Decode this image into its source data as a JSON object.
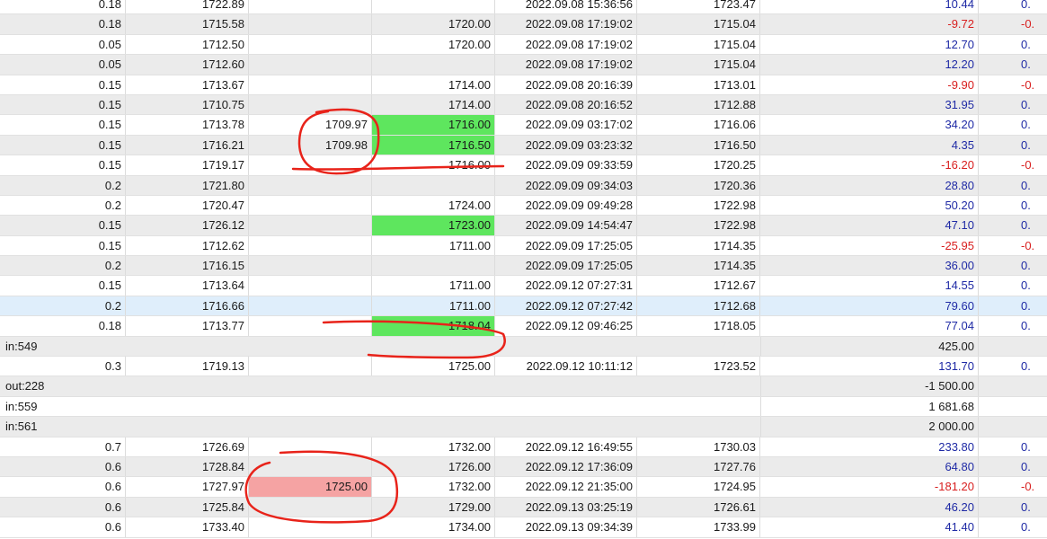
{
  "rows": [
    {
      "type": "trade",
      "alt": false,
      "lots": "0.18",
      "open": "1722.89",
      "sl": "",
      "tp": "",
      "time": "2022.09.08 15:36:56",
      "close": "1723.47",
      "profit": "10.44",
      "pc": "pos",
      "last": "0.",
      "sl_hl": "",
      "tp_hl": ""
    },
    {
      "type": "trade",
      "alt": true,
      "lots": "0.18",
      "open": "1715.58",
      "sl": "",
      "tp": "1720.00",
      "time": "2022.09.08 17:19:02",
      "close": "1715.04",
      "profit": "-9.72",
      "pc": "neg",
      "last": "-0.",
      "sl_hl": "",
      "tp_hl": ""
    },
    {
      "type": "trade",
      "alt": false,
      "lots": "0.05",
      "open": "1712.50",
      "sl": "",
      "tp": "1720.00",
      "time": "2022.09.08 17:19:02",
      "close": "1715.04",
      "profit": "12.70",
      "pc": "pos",
      "last": "0.",
      "sl_hl": "",
      "tp_hl": ""
    },
    {
      "type": "trade",
      "alt": true,
      "lots": "0.05",
      "open": "1712.60",
      "sl": "",
      "tp": "",
      "time": "2022.09.08 17:19:02",
      "close": "1715.04",
      "profit": "12.20",
      "pc": "pos",
      "last": "0.",
      "sl_hl": "",
      "tp_hl": ""
    },
    {
      "type": "trade",
      "alt": false,
      "lots": "0.15",
      "open": "1713.67",
      "sl": "",
      "tp": "1714.00",
      "time": "2022.09.08 20:16:39",
      "close": "1713.01",
      "profit": "-9.90",
      "pc": "neg",
      "last": "-0.",
      "sl_hl": "",
      "tp_hl": ""
    },
    {
      "type": "trade",
      "alt": true,
      "lots": "0.15",
      "open": "1710.75",
      "sl": "",
      "tp": "1714.00",
      "time": "2022.09.08 20:16:52",
      "close": "1712.88",
      "profit": "31.95",
      "pc": "pos",
      "last": "0.",
      "sl_hl": "",
      "tp_hl": ""
    },
    {
      "type": "trade",
      "alt": false,
      "lots": "0.15",
      "open": "1713.78",
      "sl": "1709.97",
      "tp": "1716.00",
      "time": "2022.09.09 03:17:02",
      "close": "1716.06",
      "profit": "34.20",
      "pc": "pos",
      "last": "0.",
      "sl_hl": "",
      "tp_hl": "green"
    },
    {
      "type": "trade",
      "alt": true,
      "lots": "0.15",
      "open": "1716.21",
      "sl": "1709.98",
      "tp": "1716.50",
      "time": "2022.09.09 03:23:32",
      "close": "1716.50",
      "profit": "4.35",
      "pc": "pos",
      "last": "0.",
      "sl_hl": "",
      "tp_hl": "green"
    },
    {
      "type": "trade",
      "alt": false,
      "lots": "0.15",
      "open": "1719.17",
      "sl": "",
      "tp": "1716.00",
      "time": "2022.09.09 09:33:59",
      "close": "1720.25",
      "profit": "-16.20",
      "pc": "neg",
      "last": "-0.",
      "sl_hl": "",
      "tp_hl": ""
    },
    {
      "type": "trade",
      "alt": true,
      "lots": "0.2",
      "open": "1721.80",
      "sl": "",
      "tp": "",
      "time": "2022.09.09 09:34:03",
      "close": "1720.36",
      "profit": "28.80",
      "pc": "pos",
      "last": "0.",
      "sl_hl": "",
      "tp_hl": ""
    },
    {
      "type": "trade",
      "alt": false,
      "lots": "0.2",
      "open": "1720.47",
      "sl": "",
      "tp": "1724.00",
      "time": "2022.09.09 09:49:28",
      "close": "1722.98",
      "profit": "50.20",
      "pc": "pos",
      "last": "0.",
      "sl_hl": "",
      "tp_hl": ""
    },
    {
      "type": "trade",
      "alt": true,
      "lots": "0.15",
      "open": "1726.12",
      "sl": "",
      "tp": "1723.00",
      "time": "2022.09.09 14:54:47",
      "close": "1722.98",
      "profit": "47.10",
      "pc": "pos",
      "last": "0.",
      "sl_hl": "",
      "tp_hl": "green"
    },
    {
      "type": "trade",
      "alt": false,
      "lots": "0.15",
      "open": "1712.62",
      "sl": "",
      "tp": "1711.00",
      "time": "2022.09.09 17:25:05",
      "close": "1714.35",
      "profit": "-25.95",
      "pc": "neg",
      "last": "-0.",
      "sl_hl": "",
      "tp_hl": ""
    },
    {
      "type": "trade",
      "alt": true,
      "lots": "0.2",
      "open": "1716.15",
      "sl": "",
      "tp": "",
      "time": "2022.09.09 17:25:05",
      "close": "1714.35",
      "profit": "36.00",
      "pc": "pos",
      "last": "0.",
      "sl_hl": "",
      "tp_hl": ""
    },
    {
      "type": "trade",
      "alt": false,
      "lots": "0.15",
      "open": "1713.64",
      "sl": "",
      "tp": "1711.00",
      "time": "2022.09.12 07:27:31",
      "close": "1712.67",
      "profit": "14.55",
      "pc": "pos",
      "last": "0.",
      "sl_hl": "",
      "tp_hl": ""
    },
    {
      "type": "trade",
      "alt": false,
      "sel": true,
      "lots": "0.2",
      "open": "1716.66",
      "sl": "",
      "tp": "1711.00",
      "time": "2022.09.12 07:27:42",
      "close": "1712.68",
      "profit": "79.60",
      "pc": "pos",
      "last": "0.",
      "sl_hl": "",
      "tp_hl": ""
    },
    {
      "type": "trade",
      "alt": false,
      "lots": "0.18",
      "open": "1713.77",
      "sl": "",
      "tp": "1718.04",
      "time": "2022.09.12 09:46:25",
      "close": "1718.05",
      "profit": "77.04",
      "pc": "pos",
      "last": "0.",
      "sl_hl": "",
      "tp_hl": "green"
    },
    {
      "type": "balance",
      "alt": true,
      "label": "in:549",
      "amount": "425.00"
    },
    {
      "type": "trade",
      "alt": false,
      "lots": "0.3",
      "open": "1719.13",
      "sl": "",
      "tp": "1725.00",
      "time": "2022.09.12 10:11:12",
      "close": "1723.52",
      "profit": "131.70",
      "pc": "pos",
      "last": "0.",
      "sl_hl": "",
      "tp_hl": ""
    },
    {
      "type": "balance",
      "alt": true,
      "label": "out:228",
      "amount": "-1 500.00"
    },
    {
      "type": "balance",
      "alt": false,
      "label": "in:559",
      "amount": "1 681.68"
    },
    {
      "type": "balance",
      "alt": true,
      "label": "in:561",
      "amount": "2 000.00"
    },
    {
      "type": "trade",
      "alt": false,
      "lots": "0.7",
      "open": "1726.69",
      "sl": "",
      "tp": "1732.00",
      "time": "2022.09.12 16:49:55",
      "close": "1730.03",
      "profit": "233.80",
      "pc": "pos",
      "last": "0.",
      "sl_hl": "",
      "tp_hl": ""
    },
    {
      "type": "trade",
      "alt": true,
      "lots": "0.6",
      "open": "1728.84",
      "sl": "",
      "tp": "1726.00",
      "time": "2022.09.12 17:36:09",
      "close": "1727.76",
      "profit": "64.80",
      "pc": "pos",
      "last": "0.",
      "sl_hl": "",
      "tp_hl": ""
    },
    {
      "type": "trade",
      "alt": false,
      "lots": "0.6",
      "open": "1727.97",
      "sl": "1725.00",
      "tp": "1732.00",
      "time": "2022.09.12 21:35:00",
      "close": "1724.95",
      "profit": "-181.20",
      "pc": "neg",
      "last": "-0.",
      "sl_hl": "red",
      "tp_hl": ""
    },
    {
      "type": "trade",
      "alt": true,
      "lots": "0.6",
      "open": "1725.84",
      "sl": "",
      "tp": "1729.00",
      "time": "2022.09.13 03:25:19",
      "close": "1726.61",
      "profit": "46.20",
      "pc": "pos",
      "last": "0.",
      "sl_hl": "",
      "tp_hl": ""
    },
    {
      "type": "trade",
      "alt": false,
      "lots": "0.6",
      "open": "1733.40",
      "sl": "",
      "tp": "1734.00",
      "time": "2022.09.13 09:34:39",
      "close": "1733.99",
      "profit": "41.40",
      "pc": "pos",
      "last": "0.",
      "sl_hl": "",
      "tp_hl": ""
    }
  ],
  "colors": {
    "positive": "#1f2aa5",
    "negative": "#d81f1f",
    "hl_green": "#5ee65e",
    "hl_red": "#f5a3a3",
    "annotation": "#e8231a"
  }
}
